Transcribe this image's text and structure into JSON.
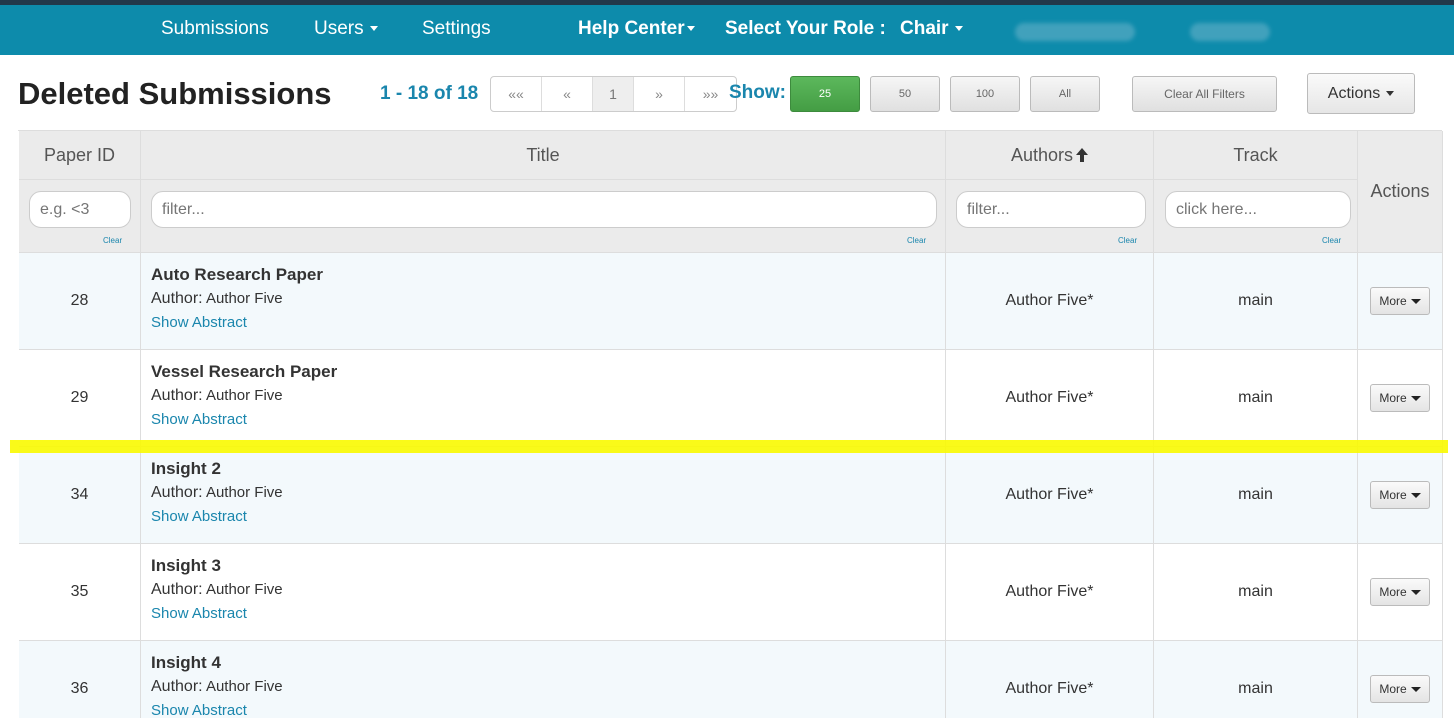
{
  "nav": {
    "submissions": "Submissions",
    "users": "Users",
    "settings": "Settings",
    "help_center": "Help Center",
    "select_role_label": "Select Your Role :",
    "role": "Chair"
  },
  "page": {
    "title": "Deleted Submissions",
    "pager_count": "1 - 18 of 18",
    "pager": {
      "first": "««",
      "prev": "«",
      "current": "1",
      "next": "»",
      "last": "»»"
    },
    "show_label": "Show:",
    "page_sizes": [
      "25",
      "50",
      "100",
      "All"
    ],
    "active_page_size": "25",
    "clear_filters": "Clear All Filters",
    "actions": "Actions"
  },
  "table": {
    "headers": {
      "paper_id": "Paper ID",
      "title": "Title",
      "authors": "Authors",
      "track": "Track",
      "actions": "Actions"
    },
    "filters": {
      "paper_id_placeholder": "e.g. <3",
      "title_placeholder": "filter...",
      "authors_placeholder": "filter...",
      "track_placeholder": "click here...",
      "clear_label": "Clear"
    },
    "author_prefix": "Author:",
    "show_abstract": "Show Abstract",
    "more_label": "More",
    "rows": [
      {
        "id": "28",
        "title": "Auto Research Paper",
        "author": "Author Five",
        "authors": "Author Five*",
        "track": "main"
      },
      {
        "id": "29",
        "title": "Vessel Research Paper",
        "author": "Author Five",
        "authors": "Author Five*",
        "track": "main"
      },
      {
        "id": "34",
        "title": "Insight 2",
        "author": "Author Five",
        "authors": "Author Five*",
        "track": "main"
      },
      {
        "id": "35",
        "title": "Insight 3",
        "author": "Author Five",
        "authors": "Author Five*",
        "track": "main"
      },
      {
        "id": "36",
        "title": "Insight 4",
        "author": "Author Five",
        "authors": "Author Five*",
        "track": "main"
      }
    ]
  },
  "colors": {
    "navbar": "#0d8bab",
    "accent": "#1a86ad",
    "active_button": "#5cb85c",
    "highlight": "#fafa00"
  }
}
